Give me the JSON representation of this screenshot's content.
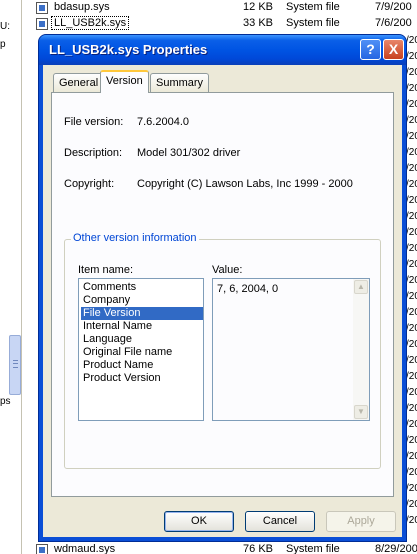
{
  "background": {
    "left_fragments": [
      "U:",
      "p",
      "ps"
    ],
    "files": [
      {
        "name": "bdasup.sys",
        "size": "12 KB",
        "type": "System file",
        "date": "7/9/200"
      },
      {
        "name": "LL_USB2k.sys",
        "size": "33 KB",
        "type": "System file",
        "date": "7/6/200",
        "selected": true
      },
      {
        "name": "wdmaud.sys",
        "size": "76 KB",
        "type": "System file",
        "date": "8/29/200"
      }
    ],
    "right_fragments": [
      "/200",
      "/200",
      "/200",
      "/200",
      "/200",
      "/200",
      "/200",
      "/200",
      "/200",
      "/200",
      "/200",
      "/200",
      "/200",
      "/200",
      "/200",
      "/200",
      "/200",
      "/200",
      "/200",
      "/200",
      "/200",
      "/200",
      "/200",
      "/200",
      "/200",
      "/200",
      "/200",
      "/200",
      "/200",
      "/200",
      "/200"
    ]
  },
  "dialog": {
    "title": "LL_USB2k.sys Properties",
    "help_glyph": "?",
    "close_glyph": "X",
    "tabs": [
      {
        "label": "General"
      },
      {
        "label": "Version"
      },
      {
        "label": "Summary"
      }
    ],
    "active_tab": "Version",
    "props": {
      "file_version_label": "File version:",
      "file_version_value": "7.6.2004.0",
      "description_label": "Description:",
      "description_value": "Model 301/302 driver",
      "copyright_label": "Copyright:",
      "copyright_value": "Copyright (C) Lawson Labs, Inc 1999 - 2000"
    },
    "other_info": {
      "legend": "Other version information",
      "item_name_label": "Item name:",
      "value_label": "Value:",
      "items": [
        "Comments",
        "Company",
        "File Version",
        "Internal Name",
        "Language",
        "Original File name",
        "Product Name",
        "Product Version"
      ],
      "selected_item": "File Version",
      "value_text": "7, 6, 2004, 0"
    },
    "buttons": {
      "ok": "OK",
      "cancel": "Cancel",
      "apply": "Apply"
    }
  }
}
